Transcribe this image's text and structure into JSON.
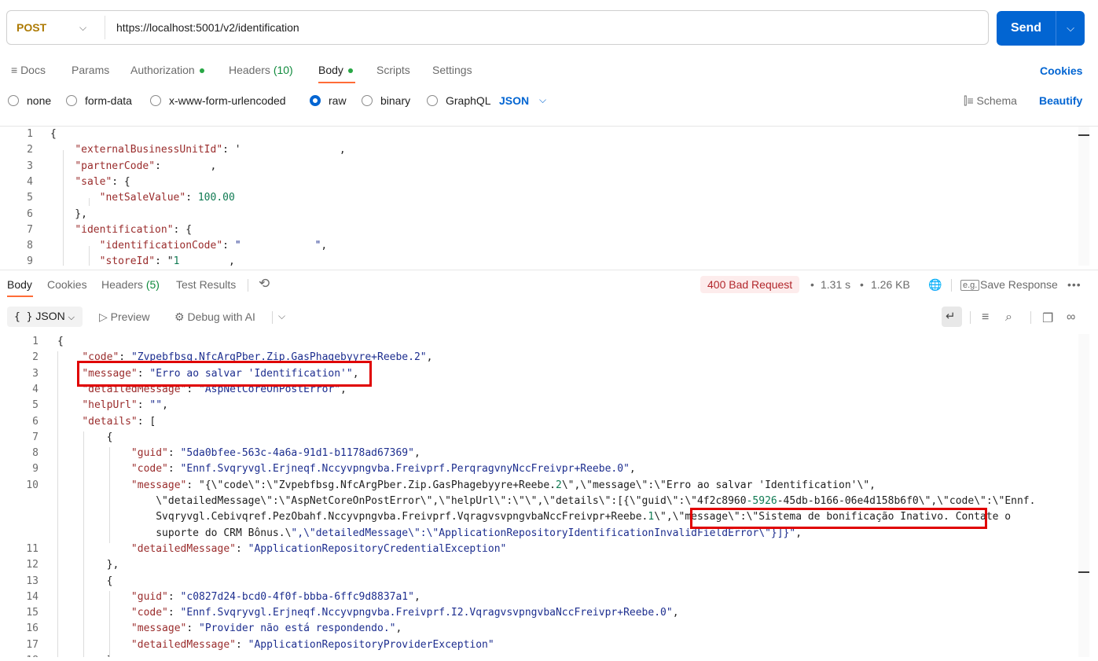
{
  "request": {
    "method": "POST",
    "url": "https://localhost:5001/v2/identification",
    "send_label": "Send"
  },
  "request_tabs": {
    "docs": "Docs",
    "params": "Params",
    "authorization": "Authorization",
    "headers": "Headers",
    "headers_count": "(10)",
    "body": "Body",
    "scripts": "Scripts",
    "settings": "Settings",
    "cookies": "Cookies"
  },
  "body_types": {
    "none": "none",
    "form_data": "form-data",
    "urlencoded": "x-www-form-urlencoded",
    "raw": "raw",
    "binary": "binary",
    "graphql": "GraphQL",
    "format": "JSON",
    "schema": "Schema",
    "beautify": "Beautify"
  },
  "request_body_lines": [
    {
      "n": "1",
      "text": "{"
    },
    {
      "n": "2",
      "text": "    \"externalBusinessUnitId\": '                ,"
    },
    {
      "n": "3",
      "text": "    \"partnerCode\":        ,"
    },
    {
      "n": "4",
      "text": "    \"sale\": {"
    },
    {
      "n": "5",
      "text": "        \"netSaleValue\": 100.00"
    },
    {
      "n": "6",
      "text": "    },"
    },
    {
      "n": "7",
      "text": "    \"identification\": {"
    },
    {
      "n": "8",
      "text": "        \"identificationCode\": \"            \","
    },
    {
      "n": "9",
      "text": "        \"storeId\": \"1        ,"
    }
  ],
  "response_tabs": {
    "body": "Body",
    "cookies": "Cookies",
    "headers": "Headers",
    "headers_count": "(5)",
    "test_results": "Test Results"
  },
  "response_meta": {
    "status": "400 Bad Request",
    "time": "1.31 s",
    "size": "1.26 KB",
    "save_response": "Save Response",
    "status_color": "#b2272c"
  },
  "response_toolbar": {
    "format": "JSON",
    "preview": "Preview",
    "debug": "Debug with AI"
  },
  "response_body_lines": [
    {
      "n": "1",
      "text": "{"
    },
    {
      "n": "2",
      "text": "    \"code\": \"Zvpebfbsg.NfcArgPber.Zip.GasPhagebyyre+Reebe.2\","
    },
    {
      "n": "3",
      "text": "    \"message\": \"Erro ao salvar 'Identification'\","
    },
    {
      "n": "4",
      "text": "    \"detailedMessage\": \"AspNetCoreOnPostError\","
    },
    {
      "n": "5",
      "text": "    \"helpUrl\": \"\","
    },
    {
      "n": "6",
      "text": "    \"details\": ["
    },
    {
      "n": "7",
      "text": "        {"
    },
    {
      "n": "8",
      "text": "            \"guid\": \"5da0bfee-563c-4a6a-91d1-b1178ad67369\","
    },
    {
      "n": "9",
      "text": "            \"code\": \"Ennf.Svqryvgl.Erjneqf.Nccyvpngvba.Freivprf.PerqragvnyNccFreivpr+Reebe.0\","
    },
    {
      "n": "10",
      "text": "            \"message\": \"{\\\"code\\\":\\\"Zvpebfbsg.NfcArgPber.Zip.GasPhagebyyre+Reebe.2\\\",\\\"message\\\":\\\"Erro ao salvar 'Identification'\\\","
    },
    {
      "n": "",
      "text": "                \\\"detailedMessage\\\":\\\"AspNetCoreOnPostError\\\",\\\"helpUrl\\\":\\\"\\\",\\\"details\\\":[{\\\"guid\\\":\\\"4f2c8960-5926-45db-b166-06e4d158b6f0\\\",\\\"code\\\":\\\"Ennf."
    },
    {
      "n": "",
      "text": "                Svqryvgl.Cebivqref.PezObahf.Nccyvpngvba.Freivprf.VqragvsvpngvbaNccFreivpr+Reebe.1\\\",\\\"message\\\":\\\"Sistema de bonificação Inativo. Contate o"
    },
    {
      "n": "",
      "text": "                suporte do CRM Bônus.\\\",\\\"detailedMessage\\\":\\\"ApplicationRepositoryIdentificationInvalidFieldError\\\"}]}\","
    },
    {
      "n": "11",
      "text": "            \"detailedMessage\": \"ApplicationRepositoryCredentialException\""
    },
    {
      "n": "12",
      "text": "        },"
    },
    {
      "n": "13",
      "text": "        {"
    },
    {
      "n": "14",
      "text": "            \"guid\": \"c0827d24-bcd0-4f0f-bbba-6ffc9d8837a1\","
    },
    {
      "n": "15",
      "text": "            \"code\": \"Ennf.Svqryvgl.Erjneqf.Nccyvpngvba.Freivprf.I2.VqragvsvpngvbaNccFreivpr+Reebe.0\","
    },
    {
      "n": "16",
      "text": "            \"message\": \"Provider não está respondendo.\","
    },
    {
      "n": "17",
      "text": "            \"detailedMessage\": \"ApplicationRepositoryProviderException\""
    },
    {
      "n": "18",
      "text": "        }"
    }
  ],
  "colors": {
    "accent": "#0265d2",
    "tab_underline": "#ff6c37",
    "highlight_box": "#e00000",
    "method": "#ad7a03"
  }
}
